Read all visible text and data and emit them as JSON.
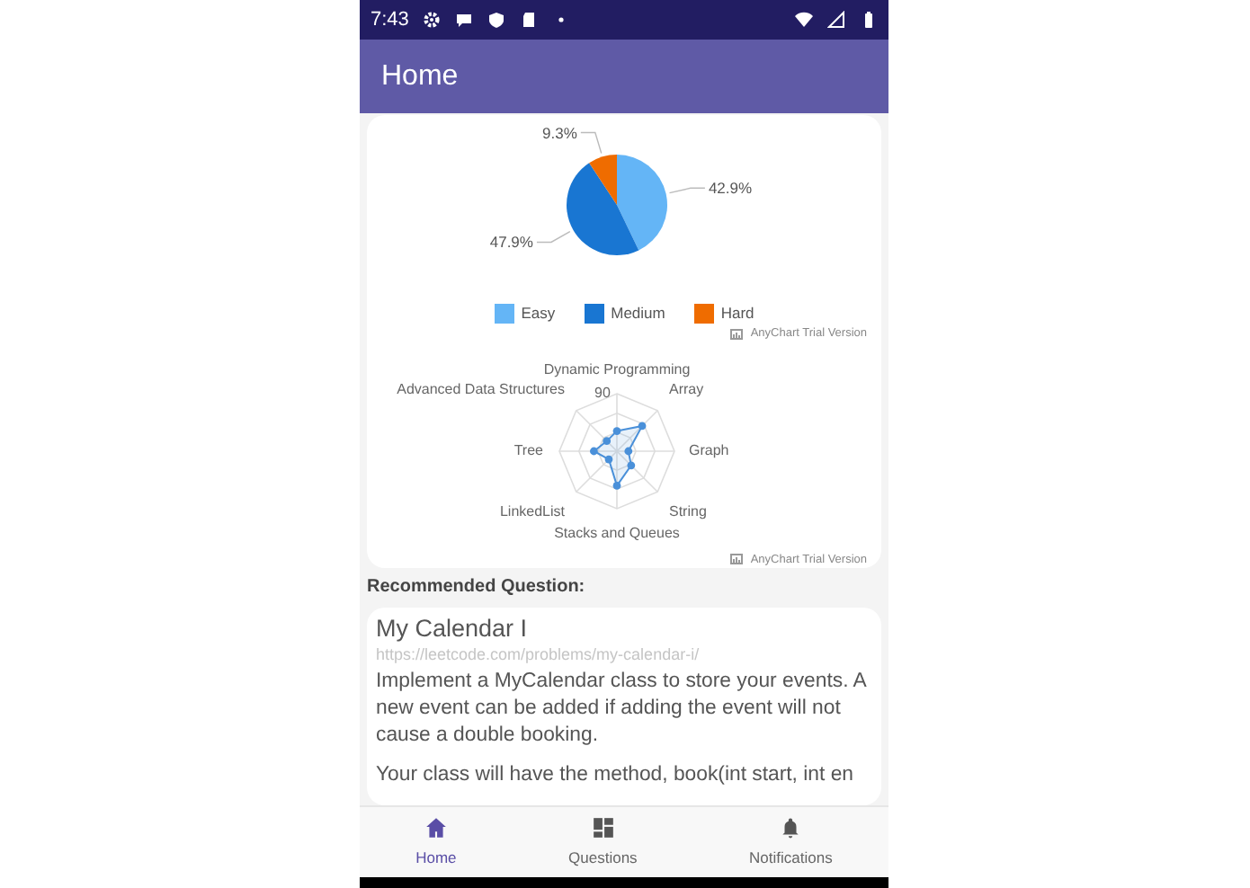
{
  "status_bar": {
    "time": "7:43"
  },
  "app_bar": {
    "title": "Home"
  },
  "pie_card": {
    "chart_data": {
      "type": "pie",
      "categories": [
        "Easy",
        "Medium",
        "Hard"
      ],
      "values": [
        42.9,
        47.9,
        9.3
      ],
      "data_labels": true,
      "value_labels": [
        "42.9%",
        "47.9%",
        "9.3%"
      ]
    },
    "legend": [
      {
        "color": "#64b5f6"
      },
      {
        "color": "#1976d2"
      },
      {
        "color": "#ef6c00"
      }
    ],
    "watermark": "AnyChart Trial Version"
  },
  "radar_card": {
    "axis_labels": [
      "Dynamic Programming",
      "Advanced Data Structures",
      "Array",
      "Tree",
      "Graph",
      "LinkedList",
      "String",
      "Stacks and Queues"
    ],
    "tick_label": "90",
    "watermark": "AnyChart Trial Version"
  },
  "recommended": {
    "heading": "Recommended Question:",
    "title": "My Calendar I",
    "url": "https://leetcode.com/problems/my-calendar-i/",
    "description": "Implement a MyCalendar class to store your events. A new event can be added if adding the event will not cause a double booking.",
    "description_more": "Your class will have the method, book(int start, int en"
  },
  "bottom_nav": [
    {
      "label": "Home",
      "selected": true
    },
    {
      "label": "Questions",
      "selected": false
    },
    {
      "label": "Notifications",
      "selected": false
    }
  ]
}
